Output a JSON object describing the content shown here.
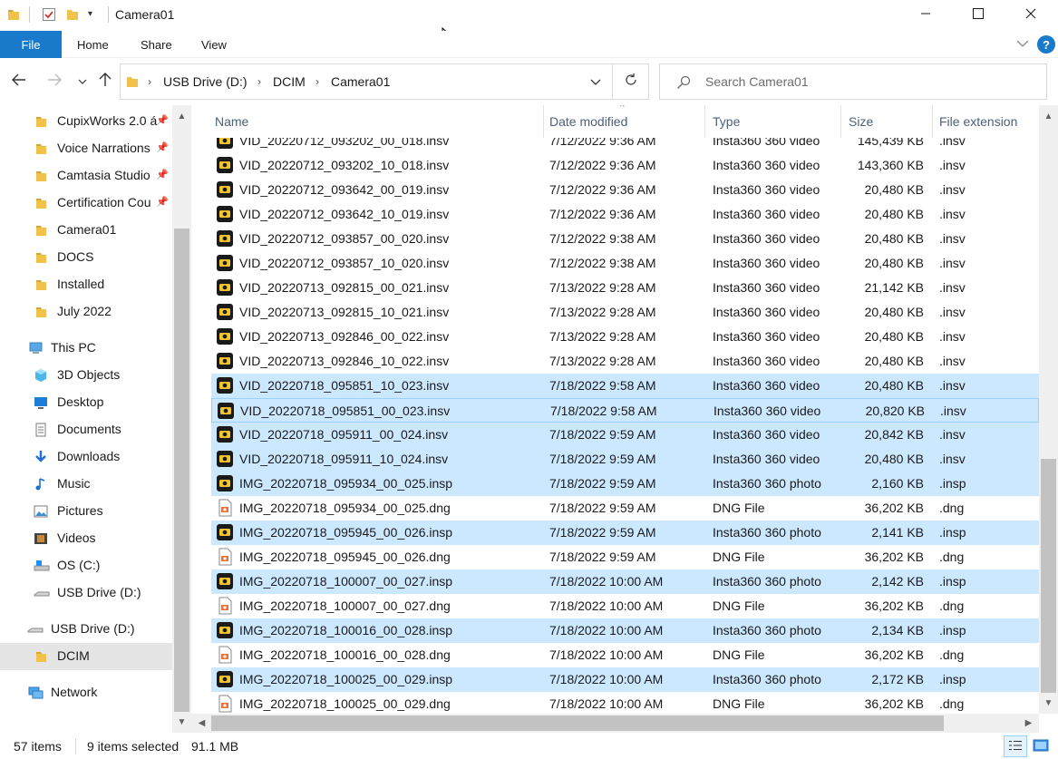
{
  "window": {
    "title": "Camera01",
    "minimize_icon": "minimize-icon",
    "maximize_icon": "maximize-icon",
    "close_icon": "close-icon"
  },
  "ribbon": {
    "file": "File",
    "tabs": [
      "Home",
      "Share",
      "View"
    ],
    "help": "?"
  },
  "address": {
    "crumbs": [
      "USB Drive (D:)",
      "DCIM",
      "Camera01"
    ]
  },
  "search": {
    "placeholder": "Search Camera01"
  },
  "nav": {
    "items": [
      {
        "label": "CupixWorks 2.0 á",
        "icon": "folder-icon",
        "pinned": true,
        "indent": 1
      },
      {
        "label": "Voice Narrations",
        "icon": "folder-icon",
        "pinned": true,
        "indent": 1
      },
      {
        "label": "Camtasia Studio",
        "icon": "folder-icon",
        "pinned": true,
        "indent": 1
      },
      {
        "label": "Certification Cou",
        "icon": "folder-icon",
        "pinned": true,
        "indent": 1
      },
      {
        "label": "Camera01",
        "icon": "folder-icon",
        "pinned": false,
        "indent": 1
      },
      {
        "label": "DOCS",
        "icon": "folder-icon",
        "pinned": false,
        "indent": 1
      },
      {
        "label": "Installed",
        "icon": "folder-icon",
        "pinned": false,
        "indent": 1
      },
      {
        "label": "July 2022",
        "icon": "folder-icon",
        "pinned": false,
        "indent": 1
      },
      {
        "label": "This PC",
        "icon": "this-pc-icon",
        "pinned": false,
        "indent": 0
      },
      {
        "label": "3D Objects",
        "icon": "3d-objects-icon",
        "pinned": false,
        "indent": 1
      },
      {
        "label": "Desktop",
        "icon": "desktop-icon",
        "pinned": false,
        "indent": 1
      },
      {
        "label": "Documents",
        "icon": "documents-icon",
        "pinned": false,
        "indent": 1
      },
      {
        "label": "Downloads",
        "icon": "downloads-icon",
        "pinned": false,
        "indent": 1
      },
      {
        "label": "Music",
        "icon": "music-icon",
        "pinned": false,
        "indent": 1
      },
      {
        "label": "Pictures",
        "icon": "pictures-icon",
        "pinned": false,
        "indent": 1
      },
      {
        "label": "Videos",
        "icon": "videos-icon",
        "pinned": false,
        "indent": 1
      },
      {
        "label": "OS (C:)",
        "icon": "os-drive-icon",
        "pinned": false,
        "indent": 1
      },
      {
        "label": "USB Drive (D:)",
        "icon": "usb-drive-icon",
        "pinned": false,
        "indent": 1
      },
      {
        "label": "USB Drive (D:)",
        "icon": "usb-drive-icon",
        "pinned": false,
        "indent": 0
      },
      {
        "label": "DCIM",
        "icon": "folder-icon",
        "pinned": false,
        "indent": 1,
        "selected": true
      },
      {
        "label": "Network",
        "icon": "network-icon",
        "pinned": false,
        "indent": 0
      }
    ]
  },
  "columns": {
    "name": "Name",
    "date": "Date modified",
    "type": "Type",
    "size": "Size",
    "ext": "File extension"
  },
  "files": [
    {
      "name": "VID_20220712_093202_00_018.insv",
      "date": "7/12/2022 9:36 AM",
      "type": "Insta360 360 video",
      "size": "145,439 KB",
      "ext": ".insv",
      "icon": "insta360-icon",
      "selected": false
    },
    {
      "name": "VID_20220712_093202_10_018.insv",
      "date": "7/12/2022 9:36 AM",
      "type": "Insta360 360 video",
      "size": "143,360 KB",
      "ext": ".insv",
      "icon": "insta360-icon",
      "selected": false
    },
    {
      "name": "VID_20220712_093642_00_019.insv",
      "date": "7/12/2022 9:36 AM",
      "type": "Insta360 360 video",
      "size": "20,480 KB",
      "ext": ".insv",
      "icon": "insta360-icon",
      "selected": false
    },
    {
      "name": "VID_20220712_093642_10_019.insv",
      "date": "7/12/2022 9:36 AM",
      "type": "Insta360 360 video",
      "size": "20,480 KB",
      "ext": ".insv",
      "icon": "insta360-icon",
      "selected": false
    },
    {
      "name": "VID_20220712_093857_00_020.insv",
      "date": "7/12/2022 9:38 AM",
      "type": "Insta360 360 video",
      "size": "20,480 KB",
      "ext": ".insv",
      "icon": "insta360-icon",
      "selected": false
    },
    {
      "name": "VID_20220712_093857_10_020.insv",
      "date": "7/12/2022 9:38 AM",
      "type": "Insta360 360 video",
      "size": "20,480 KB",
      "ext": ".insv",
      "icon": "insta360-icon",
      "selected": false
    },
    {
      "name": "VID_20220713_092815_00_021.insv",
      "date": "7/13/2022 9:28 AM",
      "type": "Insta360 360 video",
      "size": "21,142 KB",
      "ext": ".insv",
      "icon": "insta360-icon",
      "selected": false
    },
    {
      "name": "VID_20220713_092815_10_021.insv",
      "date": "7/13/2022 9:28 AM",
      "type": "Insta360 360 video",
      "size": "20,480 KB",
      "ext": ".insv",
      "icon": "insta360-icon",
      "selected": false
    },
    {
      "name": "VID_20220713_092846_00_022.insv",
      "date": "7/13/2022 9:28 AM",
      "type": "Insta360 360 video",
      "size": "20,480 KB",
      "ext": ".insv",
      "icon": "insta360-icon",
      "selected": false
    },
    {
      "name": "VID_20220713_092846_10_022.insv",
      "date": "7/13/2022 9:28 AM",
      "type": "Insta360 360 video",
      "size": "20,480 KB",
      "ext": ".insv",
      "icon": "insta360-icon",
      "selected": false
    },
    {
      "name": "VID_20220718_095851_10_023.insv",
      "date": "7/18/2022 9:58 AM",
      "type": "Insta360 360 video",
      "size": "20,480 KB",
      "ext": ".insv",
      "icon": "insta360-icon",
      "selected": true
    },
    {
      "name": "VID_20220718_095851_00_023.insv",
      "date": "7/18/2022 9:58 AM",
      "type": "Insta360 360 video",
      "size": "20,820 KB",
      "ext": ".insv",
      "icon": "insta360-icon",
      "selected": true,
      "focused": true
    },
    {
      "name": "VID_20220718_095911_00_024.insv",
      "date": "7/18/2022 9:59 AM",
      "type": "Insta360 360 video",
      "size": "20,842 KB",
      "ext": ".insv",
      "icon": "insta360-icon",
      "selected": true
    },
    {
      "name": "VID_20220718_095911_10_024.insv",
      "date": "7/18/2022 9:59 AM",
      "type": "Insta360 360 video",
      "size": "20,480 KB",
      "ext": ".insv",
      "icon": "insta360-icon",
      "selected": true
    },
    {
      "name": "IMG_20220718_095934_00_025.insp",
      "date": "7/18/2022 9:59 AM",
      "type": "Insta360 360 photo",
      "size": "2,160 KB",
      "ext": ".insp",
      "icon": "insta360-icon",
      "selected": true
    },
    {
      "name": "IMG_20220718_095934_00_025.dng",
      "date": "7/18/2022 9:59 AM",
      "type": "DNG File",
      "size": "36,202 KB",
      "ext": ".dng",
      "icon": "dng-file-icon",
      "selected": false
    },
    {
      "name": "IMG_20220718_095945_00_026.insp",
      "date": "7/18/2022 9:59 AM",
      "type": "Insta360 360 photo",
      "size": "2,141 KB",
      "ext": ".insp",
      "icon": "insta360-icon",
      "selected": true
    },
    {
      "name": "IMG_20220718_095945_00_026.dng",
      "date": "7/18/2022 9:59 AM",
      "type": "DNG File",
      "size": "36,202 KB",
      "ext": ".dng",
      "icon": "dng-file-icon",
      "selected": false
    },
    {
      "name": "IMG_20220718_100007_00_027.insp",
      "date": "7/18/2022 10:00 AM",
      "type": "Insta360 360 photo",
      "size": "2,142 KB",
      "ext": ".insp",
      "icon": "insta360-icon",
      "selected": true
    },
    {
      "name": "IMG_20220718_100007_00_027.dng",
      "date": "7/18/2022 10:00 AM",
      "type": "DNG File",
      "size": "36,202 KB",
      "ext": ".dng",
      "icon": "dng-file-icon",
      "selected": false
    },
    {
      "name": "IMG_20220718_100016_00_028.insp",
      "date": "7/18/2022 10:00 AM",
      "type": "Insta360 360 photo",
      "size": "2,134 KB",
      "ext": ".insp",
      "icon": "insta360-icon",
      "selected": true
    },
    {
      "name": "IMG_20220718_100016_00_028.dng",
      "date": "7/18/2022 10:00 AM",
      "type": "DNG File",
      "size": "36,202 KB",
      "ext": ".dng",
      "icon": "dng-file-icon",
      "selected": false
    },
    {
      "name": "IMG_20220718_100025_00_029.insp",
      "date": "7/18/2022 10:00 AM",
      "type": "Insta360 360 photo",
      "size": "2,172 KB",
      "ext": ".insp",
      "icon": "insta360-icon",
      "selected": true
    },
    {
      "name": "IMG_20220718_100025_00_029.dng",
      "date": "7/18/2022 10:00 AM",
      "type": "DNG File",
      "size": "36,202 KB",
      "ext": ".dng",
      "icon": "dng-file-icon",
      "selected": false
    }
  ],
  "status": {
    "items": "57 items",
    "selected": "9 items selected",
    "size": "91.1 MB"
  },
  "colors": {
    "accent": "#1979ca",
    "selection": "#cce8ff",
    "header_text": "#4c607a"
  }
}
